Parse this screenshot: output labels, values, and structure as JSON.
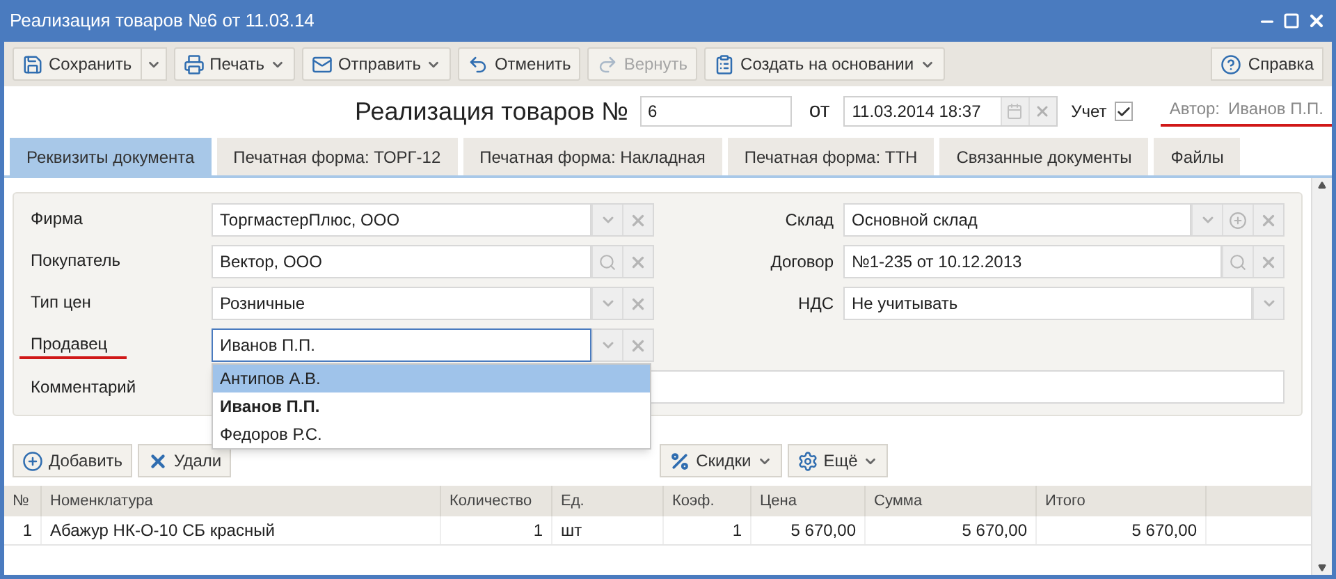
{
  "window": {
    "title": "Реализация товаров №6 от 11.03.14"
  },
  "toolbar": [
    {
      "label": "Сохранить",
      "kind": "save",
      "split": true,
      "menu": false,
      "disabled": false
    },
    {
      "label": "Печать",
      "kind": "print",
      "split": false,
      "menu": true,
      "disabled": false
    },
    {
      "label": "Отправить",
      "kind": "mail",
      "split": false,
      "menu": true,
      "disabled": false
    },
    {
      "label": "Отменить",
      "kind": "undo",
      "split": false,
      "menu": false,
      "disabled": false
    },
    {
      "label": "Вернуть",
      "kind": "redo",
      "split": false,
      "menu": false,
      "disabled": true
    },
    {
      "label": "Создать на основании",
      "kind": "clipboard",
      "split": false,
      "menu": true,
      "disabled": false
    }
  ],
  "help_button": {
    "label": "Справка"
  },
  "header": {
    "title": "Реализация товаров №",
    "number": "6",
    "date_label": "от",
    "date": "11.03.2014 18:37",
    "accounting": {
      "label": "Учет",
      "checked": true
    },
    "author": {
      "label": "Автор:",
      "value": "Иванов П.П.",
      "marked": true
    }
  },
  "tabs": [
    {
      "label": "Реквизиты документа",
      "selected": true
    },
    {
      "label": "Печатная форма: ТОРГ-12",
      "selected": false
    },
    {
      "label": "Печатная форма: Накладная",
      "selected": false
    },
    {
      "label": "Печатная форма: ТТН",
      "selected": false
    },
    {
      "label": "Связанные документы",
      "selected": false
    },
    {
      "label": "Файлы",
      "selected": false
    }
  ],
  "form": {
    "left": [
      {
        "label": "Фирма",
        "value": "ТоргмастерПлюс, ООО",
        "buttons": [
          {
            "kind": "dropdown"
          },
          {
            "kind": "clear"
          }
        ],
        "marked": false,
        "focused": false
      },
      {
        "label": "Покупатель",
        "value": "Вектор, ООО",
        "buttons": [
          {
            "kind": "search"
          },
          {
            "kind": "clear"
          }
        ],
        "marked": false,
        "focused": false
      },
      {
        "label": "Тип цен",
        "value": "Розничные",
        "buttons": [
          {
            "kind": "dropdown"
          },
          {
            "kind": "clear"
          }
        ],
        "marked": false,
        "focused": false
      },
      {
        "label": "Продавец",
        "value": "Иванов П.П.",
        "buttons": [
          {
            "kind": "dropdown"
          },
          {
            "kind": "clear"
          }
        ],
        "marked": true,
        "focused": true
      }
    ],
    "right": [
      {
        "label": "Склад",
        "value": "Основной склад",
        "buttons": [
          {
            "kind": "dropdown"
          },
          {
            "kind": "add"
          },
          {
            "kind": "clear"
          }
        ]
      },
      {
        "label": "Договор",
        "value": "№1-235 от 10.12.2013",
        "buttons": [
          {
            "kind": "search"
          },
          {
            "kind": "clear"
          }
        ]
      },
      {
        "label": "НДС",
        "value": "Не учитывать",
        "buttons": [
          {
            "kind": "dropdown"
          }
        ]
      }
    ],
    "comment": {
      "label": "Комментарий"
    }
  },
  "dropdown": {
    "items": [
      {
        "label": "Антипов А.В.",
        "selected": true,
        "current": false
      },
      {
        "label": "Иванов П.П.",
        "selected": false,
        "current": true
      },
      {
        "label": "Федоров Р.С.",
        "selected": false,
        "current": false
      }
    ]
  },
  "table_toolbar": {
    "left": [
      {
        "label": "Добавить",
        "kind": "add",
        "menu": false
      },
      {
        "label": "Удали",
        "kind": "delete",
        "menu": false
      }
    ],
    "right": [
      {
        "label": "Скидки",
        "kind": "percent",
        "menu": true
      },
      {
        "label": "Ещё",
        "kind": "gear",
        "menu": true
      }
    ]
  },
  "table": {
    "columns": [
      {
        "label": "№",
        "kind": "number"
      },
      {
        "label": "Номенклатура",
        "kind": "text"
      },
      {
        "label": "Количество",
        "kind": "number"
      },
      {
        "label": "Ед.",
        "kind": "text"
      },
      {
        "label": "Коэф.",
        "kind": "number"
      },
      {
        "label": "Цена",
        "kind": "number"
      },
      {
        "label": "Сумма",
        "kind": "number"
      },
      {
        "label": "Итого",
        "kind": "number"
      }
    ],
    "rows": [
      [
        "1",
        "Абажур НК-О-10 СБ красный",
        "1",
        "шт",
        "1",
        "5 670,00",
        "5 670,00",
        "5 670,00"
      ]
    ]
  }
}
